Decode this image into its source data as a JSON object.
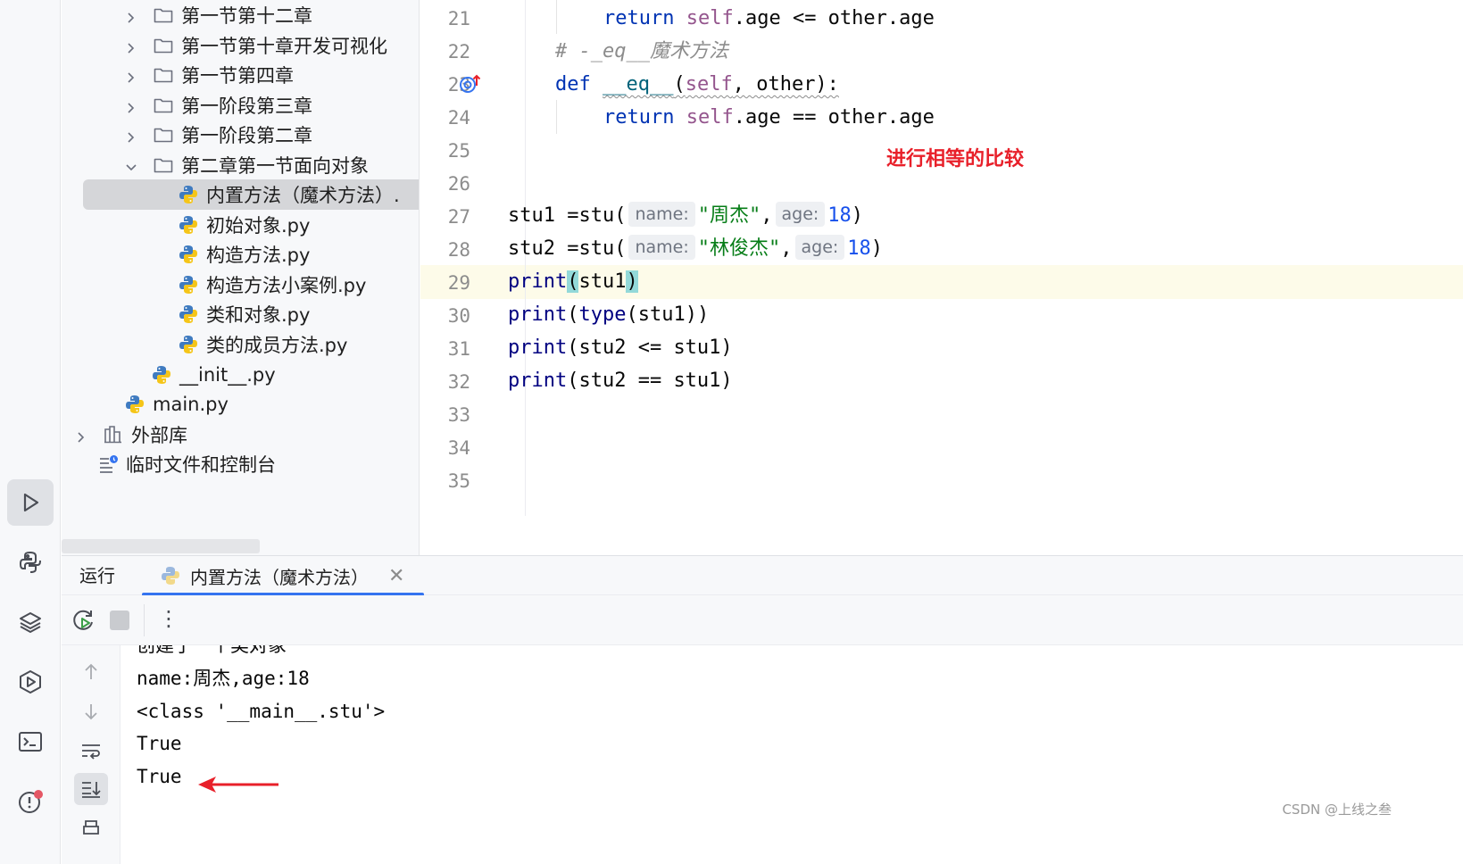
{
  "project_tree": [
    {
      "label": "第一节第十二章",
      "type": "folder",
      "expanded": false
    },
    {
      "label": "第一节第十章开发可视化",
      "type": "folder",
      "expanded": false
    },
    {
      "label": "第一节第四章",
      "type": "folder",
      "expanded": false
    },
    {
      "label": "第一阶段第三章",
      "type": "folder",
      "expanded": false
    },
    {
      "label": "第一阶段第二章",
      "type": "folder",
      "expanded": false
    },
    {
      "label": "第二章第一节面向对象",
      "type": "folder",
      "expanded": true
    },
    {
      "label": "内置方法（魔术方法）.",
      "type": "python-file",
      "selected": true
    },
    {
      "label": "初始对象.py",
      "type": "python-file"
    },
    {
      "label": "构造方法.py",
      "type": "python-file"
    },
    {
      "label": "构造方法小案例.py",
      "type": "python-file"
    },
    {
      "label": "类和对象.py",
      "type": "python-file"
    },
    {
      "label": "类的成员方法.py",
      "type": "python-file"
    },
    {
      "label": "__init__.py",
      "type": "python-file"
    },
    {
      "label": "main.py",
      "type": "python-file"
    },
    {
      "label": "外部库",
      "type": "library"
    },
    {
      "label": "临时文件和控制台",
      "type": "scratches"
    }
  ],
  "editor": {
    "line_numbers": [
      "21",
      "22",
      "23",
      "24",
      "25",
      "26",
      "27",
      "28",
      "29",
      "30",
      "31",
      "32",
      "33",
      "34",
      "35"
    ],
    "current_line": "29",
    "code": {
      "l21": {
        "kw": "return",
        "self": "self",
        "rest": ".age <= other.age"
      },
      "l22": {
        "comment": "# -_eq__魔术方法"
      },
      "l23": {
        "kw": "def",
        "fn": "__eq__",
        "open": "(",
        "self": "self",
        "rest": ", other):"
      },
      "l24": {
        "kw": "return",
        "self": "self",
        "rest": ".age == other.age"
      },
      "l27": {
        "pre": "stu1 =stu(",
        "hint1": "name:",
        "str": "\"周杰\"",
        "comma": ",",
        "hint2": "age:",
        "num": "18",
        "close": ")"
      },
      "l28": {
        "pre": "stu2 =stu(",
        "hint1": "name:",
        "str": "\"林俊杰\"",
        "comma": ",",
        "hint2": "age:",
        "num": "18",
        "close": ")"
      },
      "l29": {
        "fn": "print",
        "open": "(",
        "arg": "stu1",
        "close": ")"
      },
      "l30": {
        "fn": "print",
        "open": "(",
        "fn2": "type",
        "rest": "(stu1))"
      },
      "l31": {
        "fn": "print",
        "rest": "(stu2 <= stu1)"
      },
      "l32": {
        "fn": "print",
        "rest": "(stu2 == stu1)"
      }
    },
    "annotation": "进行相等的比较",
    "annotation_color": "#e8202a"
  },
  "run_window": {
    "title": "运行",
    "tab_label": "内置方法（魔术方法）",
    "output": [
      "创建了一个类对象",
      "name:周杰,age:18",
      "<class '__main__.stu'>",
      "True",
      "True"
    ]
  },
  "watermark": "CSDN @上线之叁",
  "colors": {
    "keyword": "#0033b3",
    "self": "#94558d",
    "string": "#067d17",
    "number": "#1750eb",
    "accent": "#3574f0",
    "arrow": "#e8202a"
  },
  "icons": {
    "toolstrip": [
      "run-icon",
      "python-console-icon",
      "layers-icon",
      "services-icon",
      "terminal-icon",
      "problems-icon"
    ],
    "run_toolbar": [
      "rerun-icon",
      "stop-icon",
      "more-icon"
    ],
    "console_side": [
      "up-arrow-icon",
      "down-arrow-icon",
      "soft-wrap-icon",
      "scroll-to-end-icon",
      "print-icon"
    ]
  }
}
